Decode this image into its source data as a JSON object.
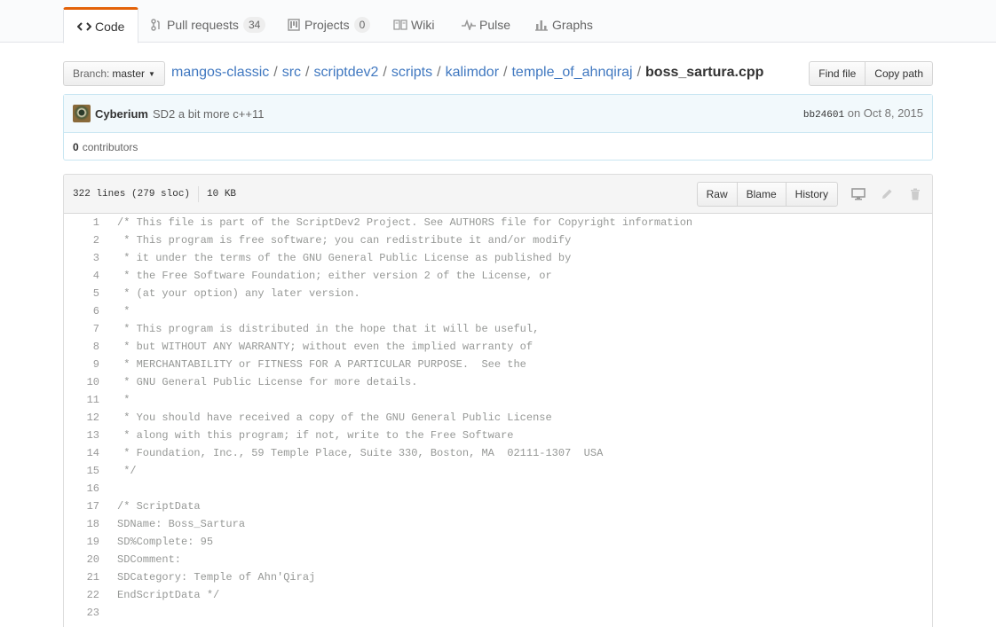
{
  "tabs": [
    {
      "label": "Code",
      "icon": "code-icon"
    },
    {
      "label": "Pull requests",
      "icon": "pull-request-icon",
      "count": "34"
    },
    {
      "label": "Projects",
      "icon": "project-icon",
      "count": "0"
    },
    {
      "label": "Wiki",
      "icon": "book-icon"
    },
    {
      "label": "Pulse",
      "icon": "pulse-icon"
    },
    {
      "label": "Graphs",
      "icon": "graph-icon"
    }
  ],
  "branch": {
    "label": "Branch:",
    "value": "master"
  },
  "breadcrumb": {
    "segments": [
      "mangos-classic",
      "src",
      "scriptdev2",
      "scripts",
      "kalimdor",
      "temple_of_ahnqiraj"
    ],
    "separator": "/",
    "final": "boss_sartura.cpp"
  },
  "file_actions": {
    "find_file": "Find file",
    "copy_path": "Copy path"
  },
  "commit": {
    "author": "Cyberium",
    "message": "SD2 a bit more c++11",
    "sha": "bb24601",
    "date": "on Oct 8, 2015"
  },
  "contributors": {
    "count": "0",
    "label": "contributors"
  },
  "file": {
    "lines_info": "322 lines (279 sloc)",
    "size": "10 KB",
    "buttons": {
      "raw": "Raw",
      "blame": "Blame",
      "history": "History"
    }
  },
  "code_lines": [
    {
      "n": "1",
      "text": "/* This file is part of the ScriptDev2 Project. See AUTHORS file for Copyright information"
    },
    {
      "n": "2",
      "text": " * This program is free software; you can redistribute it and/or modify"
    },
    {
      "n": "3",
      "text": " * it under the terms of the GNU General Public License as published by"
    },
    {
      "n": "4",
      "text": " * the Free Software Foundation; either version 2 of the License, or"
    },
    {
      "n": "5",
      "text": " * (at your option) any later version."
    },
    {
      "n": "6",
      "text": " *"
    },
    {
      "n": "7",
      "text": " * This program is distributed in the hope that it will be useful,"
    },
    {
      "n": "8",
      "text": " * but WITHOUT ANY WARRANTY; without even the implied warranty of"
    },
    {
      "n": "9",
      "text": " * MERCHANTABILITY or FITNESS FOR A PARTICULAR PURPOSE.  See the"
    },
    {
      "n": "10",
      "text": " * GNU General Public License for more details."
    },
    {
      "n": "11",
      "text": " *"
    },
    {
      "n": "12",
      "text": " * You should have received a copy of the GNU General Public License"
    },
    {
      "n": "13",
      "text": " * along with this program; if not, write to the Free Software"
    },
    {
      "n": "14",
      "text": " * Foundation, Inc., 59 Temple Place, Suite 330, Boston, MA  02111-1307  USA"
    },
    {
      "n": "15",
      "text": " */"
    },
    {
      "n": "16",
      "text": ""
    },
    {
      "n": "17",
      "text": "/* ScriptData"
    },
    {
      "n": "18",
      "text": "SDName: Boss_Sartura"
    },
    {
      "n": "19",
      "text": "SD%Complete: 95"
    },
    {
      "n": "20",
      "text": "SDComment:"
    },
    {
      "n": "21",
      "text": "SDCategory: Temple of Ahn'Qiraj"
    },
    {
      "n": "22",
      "text": "EndScriptData */"
    },
    {
      "n": "23",
      "text": ""
    }
  ]
}
